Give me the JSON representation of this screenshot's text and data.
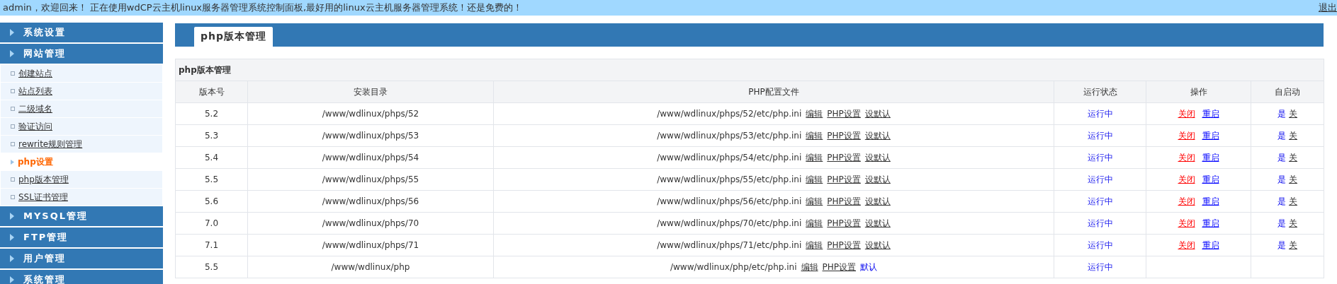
{
  "top_bar": {
    "message": "admin，欢迎回来！ 正在使用wdCP云主机linux服务器管理系统控制面板,最好用的linux云主机服务器管理系统！还是免费的！",
    "logout": "退出"
  },
  "sidebar": {
    "groups": [
      {
        "label": "系统设置"
      },
      {
        "label": "网站管理",
        "items": [
          {
            "label": "创建站点",
            "selected": false
          },
          {
            "label": "站点列表",
            "selected": false
          },
          {
            "label": "二级域名",
            "selected": false
          },
          {
            "label": "验证访问",
            "selected": false
          },
          {
            "label": "rewrite规则管理",
            "selected": false
          },
          {
            "label": "php设置",
            "selected": true
          },
          {
            "label": "php版本管理",
            "selected": false
          },
          {
            "label": "SSL证书管理",
            "selected": false
          }
        ]
      },
      {
        "label": "MYSQL管理"
      },
      {
        "label": "FTP管理"
      },
      {
        "label": "用户管理"
      },
      {
        "label": "系统管理"
      }
    ]
  },
  "main": {
    "tab": "php版本管理",
    "table": {
      "title": "php版本管理",
      "columns": [
        "版本号",
        "安装目录",
        "PHP配置文件",
        "运行状态",
        "操作",
        "自启动"
      ],
      "rows": [
        {
          "version": "5.2",
          "dir": "/www/wdlinux/phps/52",
          "ini": "/www/wdlinux/phps/52/etc/php.ini",
          "ini_actions": [
            {
              "label": "编辑",
              "kind": "link"
            },
            {
              "label": "PHP设置",
              "kind": "link"
            },
            {
              "label": "设默认",
              "kind": "link"
            }
          ],
          "status": "运行中",
          "operations": [
            {
              "label": "关闭",
              "color": "#ff0000"
            },
            {
              "label": "重启",
              "color": "#0000ff"
            }
          ],
          "autostart": [
            {
              "label": "是",
              "selected": true
            },
            {
              "label": "关",
              "selected": false
            }
          ]
        },
        {
          "version": "5.3",
          "dir": "/www/wdlinux/phps/53",
          "ini": "/www/wdlinux/phps/53/etc/php.ini",
          "ini_actions": [
            {
              "label": "编辑",
              "kind": "link"
            },
            {
              "label": "PHP设置",
              "kind": "link"
            },
            {
              "label": "设默认",
              "kind": "link"
            }
          ],
          "status": "运行中",
          "operations": [
            {
              "label": "关闭",
              "color": "#ff0000"
            },
            {
              "label": "重启",
              "color": "#0000ff"
            }
          ],
          "autostart": [
            {
              "label": "是",
              "selected": true
            },
            {
              "label": "关",
              "selected": false
            }
          ]
        },
        {
          "version": "5.4",
          "dir": "/www/wdlinux/phps/54",
          "ini": "/www/wdlinux/phps/54/etc/php.ini",
          "ini_actions": [
            {
              "label": "编辑",
              "kind": "link"
            },
            {
              "label": "PHP设置",
              "kind": "link"
            },
            {
              "label": "设默认",
              "kind": "link"
            }
          ],
          "status": "运行中",
          "operations": [
            {
              "label": "关闭",
              "color": "#ff0000"
            },
            {
              "label": "重启",
              "color": "#0000ff"
            }
          ],
          "autostart": [
            {
              "label": "是",
              "selected": true
            },
            {
              "label": "关",
              "selected": false
            }
          ]
        },
        {
          "version": "5.5",
          "dir": "/www/wdlinux/phps/55",
          "ini": "/www/wdlinux/phps/55/etc/php.ini",
          "ini_actions": [
            {
              "label": "编辑",
              "kind": "link"
            },
            {
              "label": "PHP设置",
              "kind": "link"
            },
            {
              "label": "设默认",
              "kind": "link"
            }
          ],
          "status": "运行中",
          "operations": [
            {
              "label": "关闭",
              "color": "#ff0000"
            },
            {
              "label": "重启",
              "color": "#0000ff"
            }
          ],
          "autostart": [
            {
              "label": "是",
              "selected": true
            },
            {
              "label": "关",
              "selected": false
            }
          ]
        },
        {
          "version": "5.6",
          "dir": "/www/wdlinux/phps/56",
          "ini": "/www/wdlinux/phps/56/etc/php.ini",
          "ini_actions": [
            {
              "label": "编辑",
              "kind": "link"
            },
            {
              "label": "PHP设置",
              "kind": "link"
            },
            {
              "label": "设默认",
              "kind": "link"
            }
          ],
          "status": "运行中",
          "operations": [
            {
              "label": "关闭",
              "color": "#ff0000"
            },
            {
              "label": "重启",
              "color": "#0000ff"
            }
          ],
          "autostart": [
            {
              "label": "是",
              "selected": true
            },
            {
              "label": "关",
              "selected": false
            }
          ]
        },
        {
          "version": "7.0",
          "dir": "/www/wdlinux/phps/70",
          "ini": "/www/wdlinux/phps/70/etc/php.ini",
          "ini_actions": [
            {
              "label": "编辑",
              "kind": "link"
            },
            {
              "label": "PHP设置",
              "kind": "link"
            },
            {
              "label": "设默认",
              "kind": "link"
            }
          ],
          "status": "运行中",
          "operations": [
            {
              "label": "关闭",
              "color": "#ff0000"
            },
            {
              "label": "重启",
              "color": "#0000ff"
            }
          ],
          "autostart": [
            {
              "label": "是",
              "selected": true
            },
            {
              "label": "关",
              "selected": false
            }
          ]
        },
        {
          "version": "7.1",
          "dir": "/www/wdlinux/phps/71",
          "ini": "/www/wdlinux/phps/71/etc/php.ini",
          "ini_actions": [
            {
              "label": "编辑",
              "kind": "link"
            },
            {
              "label": "PHP设置",
              "kind": "link"
            },
            {
              "label": "设默认",
              "kind": "link"
            }
          ],
          "status": "运行中",
          "operations": [
            {
              "label": "关闭",
              "color": "#ff0000"
            },
            {
              "label": "重启",
              "color": "#0000ff"
            }
          ],
          "autostart": [
            {
              "label": "是",
              "selected": true
            },
            {
              "label": "关",
              "selected": false
            }
          ]
        },
        {
          "version": "5.5",
          "dir": "/www/wdlinux/php",
          "ini": "/www/wdlinux/php/etc/php.ini",
          "ini_actions": [
            {
              "label": "编辑",
              "kind": "link"
            },
            {
              "label": "PHP设置",
              "kind": "link"
            },
            {
              "label": "默认",
              "kind": "current"
            }
          ],
          "status": "运行中"
        }
      ]
    }
  }
}
